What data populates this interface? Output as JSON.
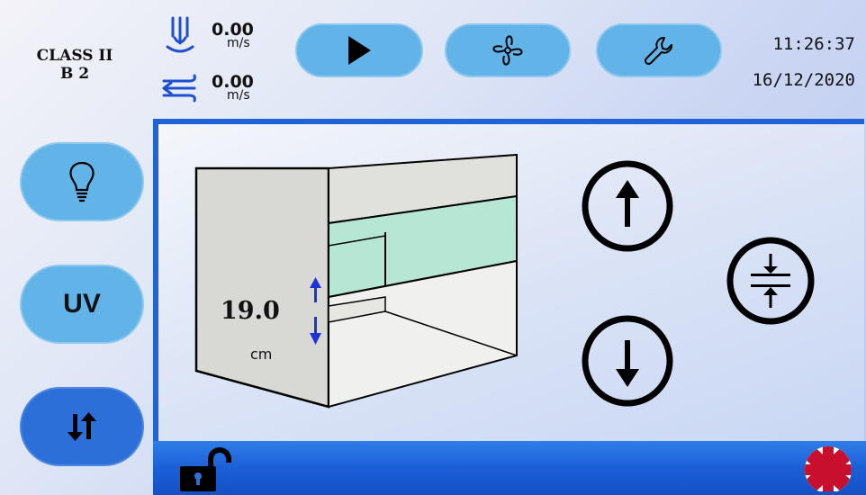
{
  "header": {
    "cabinet_class": "CLASS II",
    "cabinet_type": "B 2",
    "downflow": {
      "value": "0.00",
      "unit": "m/s",
      "icon": "downflow-icon"
    },
    "inflow": {
      "value": "0.00",
      "unit": "m/s",
      "icon": "inflow-icon"
    },
    "buttons": [
      {
        "name": "play-button",
        "icon": "play-icon"
      },
      {
        "name": "fan-button",
        "icon": "fan-icon"
      },
      {
        "name": "settings-button",
        "icon": "wrench-icon"
      }
    ],
    "time": "11:26:37",
    "date": "16/12/2020"
  },
  "sidebar": {
    "light": {
      "icon": "lightbulb-icon"
    },
    "uv": {
      "label": "UV"
    },
    "sash": {
      "icon": "sash-arrows-icon",
      "active": true
    }
  },
  "sash_panel": {
    "height_value": "19.0",
    "height_unit": "cm",
    "controls": [
      "sash-up-icon",
      "sash-down-icon",
      "sash-working-height-icon"
    ]
  },
  "footer": {
    "lock_icon": "unlocked-padlock-icon",
    "language_icon": "uk-flag-icon"
  },
  "colors": {
    "pill_button": "#61b3e8",
    "active_button": "#2c6fd8",
    "frame_blue": "#1f63d6",
    "glass_green": "#b6e6d4"
  }
}
